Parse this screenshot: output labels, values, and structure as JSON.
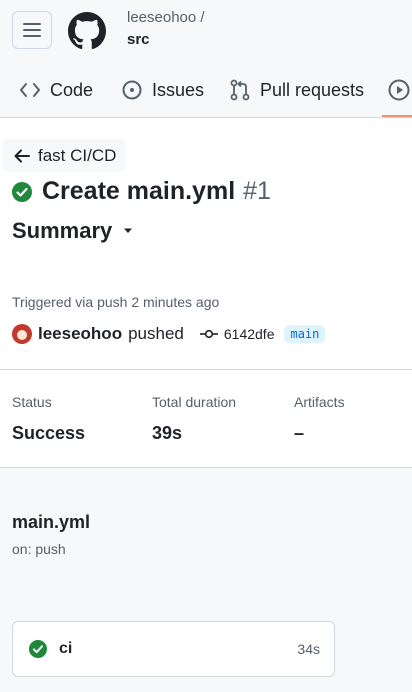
{
  "repo": {
    "owner": "leeseohoo /",
    "name": "src"
  },
  "tabs": [
    {
      "label": "Code",
      "icon": "code-icon"
    },
    {
      "label": "Issues",
      "icon": "issue-opened-icon"
    },
    {
      "label": "Pull requests",
      "icon": "git-pull-request-icon"
    },
    {
      "label": "",
      "icon": "play-icon"
    }
  ],
  "back_link": "fast CI/CD",
  "run": {
    "title": "Create main.yml",
    "number": "#1",
    "status_icon": "check-circle-fill-icon",
    "summary_label": "Summary"
  },
  "trigger": {
    "text": "Triggered via push 2 minutes ago",
    "user": "leeseohoo",
    "action": "pushed",
    "commit_sha": "6142dfe",
    "branch": "main"
  },
  "stats": [
    {
      "label": "Status",
      "value": "Success"
    },
    {
      "label": "Total duration",
      "value": "39s"
    },
    {
      "label": "Artifacts",
      "value": "–"
    }
  ],
  "workflow": {
    "file": "main.yml",
    "on": "on: push",
    "jobs": [
      {
        "name": "ci",
        "duration": "34s",
        "status": "success"
      }
    ]
  },
  "colors": {
    "success": "#1f883d",
    "accent_underline": "#fd8c73",
    "branch_bg": "#ddf4ff",
    "branch_fg": "#0969da"
  }
}
